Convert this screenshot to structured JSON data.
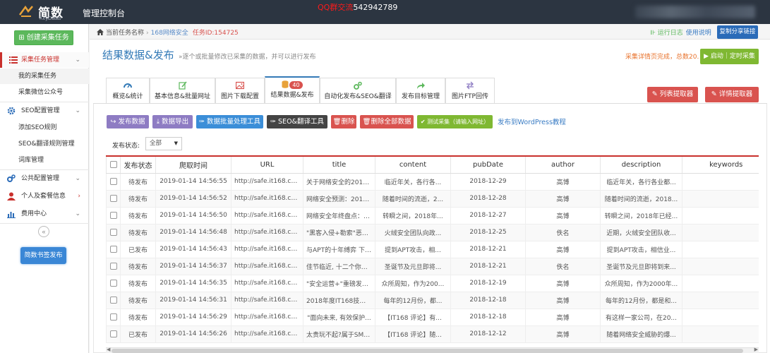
{
  "header": {
    "logo_text": "简数",
    "logo_sub": "KeyDatas",
    "app_title": "管理控制台",
    "watermark_red": "QQ群交流",
    "watermark_num": "542942789"
  },
  "sidebar": {
    "create_label": "创建采集任务",
    "sections": [
      {
        "label": "采集任务管理",
        "icon": "list-icon",
        "arrow": "⌄"
      },
      {
        "label": "SEO配置管理",
        "icon": "gear-icon",
        "arrow": "⌄"
      },
      {
        "label": "公共配置管理",
        "icon": "gears-icon",
        "arrow": "⌄"
      },
      {
        "label": "个人及套餐信息",
        "icon": "user-icon",
        "arrow": "›"
      },
      {
        "label": "费用中心",
        "icon": "bar-chart-icon",
        "arrow": "⌄"
      }
    ],
    "task_items": [
      "我的采集任务",
      "采集微信公众号"
    ],
    "seo_items": [
      "添加SEO规则",
      "SEO&翻译规则管理",
      "词库管理"
    ],
    "collapse": "«",
    "publish_label": "简数书签发布"
  },
  "breadcrumb": {
    "current_label": "当前任务名称",
    "task_name": "168网络安全",
    "task_id": "任务ID:154725"
  },
  "top_links": {
    "run_log": "运行日志",
    "guide": "使用说明",
    "share": "复制分享链接"
  },
  "page": {
    "title": "结果数据&发布",
    "desc": "»逐个或批量修改已采集的数据，并可以进行发布",
    "status_note": "采集详情页完成，总数20.",
    "start_label": "启动｜定时采集"
  },
  "tabs": [
    {
      "label": "概览&统计",
      "icon": "dashboard-icon"
    },
    {
      "label": "基本信息&批量网址",
      "icon": "edit-icon"
    },
    {
      "label": "图片下载配置",
      "icon": "image-icon"
    },
    {
      "label": "结果数据&发布",
      "icon": "database-icon",
      "badge": "40"
    },
    {
      "label": "自动化发布&SEO&翻译",
      "icon": "cogs-icon"
    },
    {
      "label": "发布目标管理",
      "icon": "share-icon"
    },
    {
      "label": "图片FTP回传",
      "icon": "exchange-icon"
    }
  ],
  "extract_buttons": {
    "list": "列表提取器",
    "detail": "详情提取器"
  },
  "actions": {
    "publish": "发布数据",
    "export": "数据导出",
    "batch": "数据批量处理工具",
    "seo": "SEO&翻译工具",
    "delete": "删除",
    "delete_all": "删除全部数据",
    "test": "测试采集（请输入网址）",
    "wp_link": "发布到WordPress教程"
  },
  "filter": {
    "label": "发布状态:",
    "selected": "全部"
  },
  "table": {
    "columns": [
      "发布状态",
      "爬取时间",
      "URL",
      "title",
      "content",
      "pubDate",
      "author",
      "description",
      "keywords"
    ],
    "rows": [
      [
        "待发布",
        "2019-01-14 14:56:55",
        "http://safe.it168.co...",
        "关于网络安全的2019，...",
        "临近年关，各行各...",
        "2018-12-29",
        "高博",
        "临近年关，各行各业都...",
        ""
      ],
      [
        "待发布",
        "2019-01-14 14:56:52",
        "http://safe.it168.co...",
        "网络安全预测：2019年...",
        "随着时间的流逝，2...",
        "2018-12-28",
        "高博",
        "随着时间的流逝，2018...",
        ""
      ],
      [
        "待发布",
        "2019-01-14 14:56:50",
        "http://safe.it168.co...",
        "网络安全年终盘点：201...",
        "转瞬之间，2018年...",
        "2018-12-27",
        "高博",
        "转瞬之间，2018年已经...",
        ""
      ],
      [
        "待发布",
        "2019-01-14 14:56:48",
        "http://safe.it168.co...",
        "\"黑客入侵+勒索\"恶性...",
        "火绒安全团队向政...",
        "2018-12-25",
        "佚名",
        "近期，火绒安全团队收...",
        ""
      ],
      [
        "已发布",
        "2019-01-14 14:56:43",
        "http://safe.it168.co...",
        "与APT的十年缚弈 下一...",
        "提到APT攻击，相...",
        "2018-12-21",
        "高博",
        "提到APT攻击，相信业...",
        ""
      ],
      [
        "待发布",
        "2019-01-14 14:56:37",
        "http://safe.it168.co...",
        "佳节临近, 十二个你要知...",
        "圣诞节及元旦即将...",
        "2018-12-21",
        "佚名",
        "圣诞节及元旦即将到来...",
        ""
      ],
      [
        "待发布",
        "2019-01-14 14:56:35",
        "http://safe.it168.co...",
        "\"安全运营+\"重磅发布...",
        "众所周知，作为200...",
        "2018-12-19",
        "高博",
        "众所周知，作为2000年...",
        ""
      ],
      [
        "待发布",
        "2019-01-14 14:56:31",
        "http://safe.it168.co...",
        "2018年度IT168技术卓...",
        "每年的12月份，都...",
        "2018-12-18",
        "高博",
        "每年的12月份，都是和...",
        ""
      ],
      [
        "待发布",
        "2019-01-14 14:56:29",
        "http://safe.it168.co...",
        "\"面向未来, 有效保护...",
        "【IT168 评论】有...",
        "2018-12-18",
        "高博",
        "有这样一家公司，在20...",
        ""
      ],
      [
        "已发布",
        "2019-01-14 14:56:26",
        "http://safe.it168.co...",
        "太贵玩不起?属于SMB企...",
        "【IT168 评论】随...",
        "2018-12-12",
        "高博",
        "随着网络安全威胁的爆...",
        ""
      ]
    ]
  },
  "colors": {
    "topbar": "#2c3541",
    "accent_red": "#c9302c",
    "accent_blue": "#337ab7",
    "green": "#5cb85c"
  }
}
